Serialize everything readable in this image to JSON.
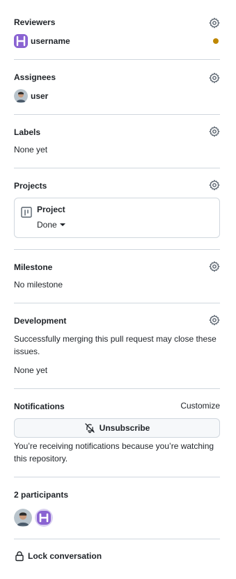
{
  "reviewers": {
    "heading": "Reviewers",
    "user": "username"
  },
  "assignees": {
    "heading": "Assignees",
    "user": "user"
  },
  "labels": {
    "heading": "Labels",
    "empty": "None yet"
  },
  "projects": {
    "heading": "Projects",
    "project_name": "Project",
    "status": "Done"
  },
  "milestone": {
    "heading": "Milestone",
    "empty": "No milestone"
  },
  "development": {
    "heading": "Development",
    "description": "Successfully merging this pull request may close these issues.",
    "empty": "None yet"
  },
  "notifications": {
    "heading": "Notifications",
    "customize": "Customize",
    "unsubscribe": "Unsubscribe",
    "reason": "You’re receiving notifications because you’re watching this repository."
  },
  "participants": {
    "heading": "2 participants"
  },
  "lock": {
    "label": "Lock conversation"
  },
  "colors": {
    "pending_dot": "#bf8700",
    "border": "#d0d7de",
    "text": "#1f2328",
    "avatar_purple": "#8a63d2"
  }
}
